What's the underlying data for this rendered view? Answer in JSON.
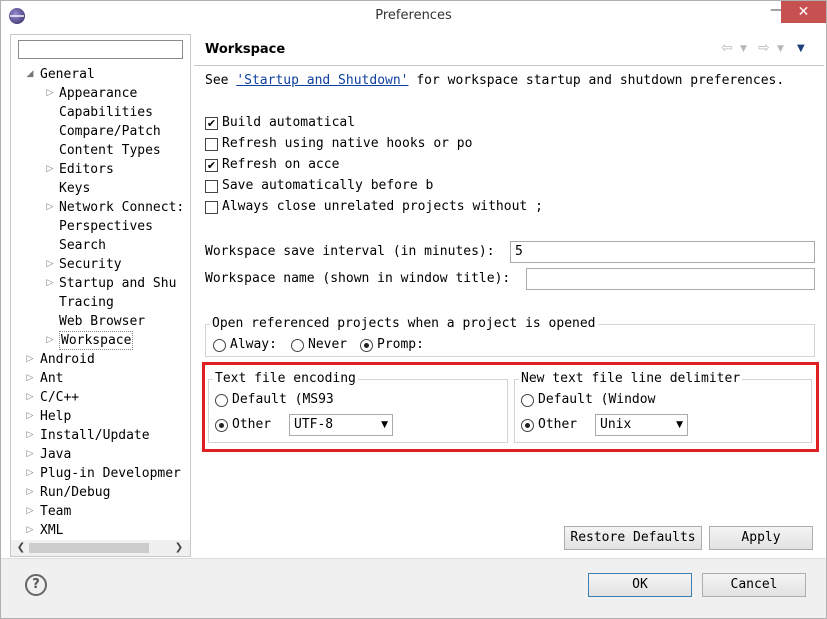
{
  "window": {
    "title": "Preferences",
    "minimize": "—",
    "close": "✕"
  },
  "filter": {
    "value": "",
    "placeholder": ""
  },
  "tree": {
    "general": "General",
    "appearance": "Appearance",
    "capabilities": "Capabilities",
    "compare_patch": "Compare/Patch",
    "content_types": "Content Types",
    "editors": "Editors",
    "keys": "Keys",
    "network": "Network Connect:",
    "perspectives": "Perspectives",
    "search": "Search",
    "security": "Security",
    "startup": "Startup and Shu",
    "tracing": "Tracing",
    "web_browser": "Web Browser",
    "workspace": "Workspace",
    "android": "Android",
    "ant": "Ant",
    "cpp": "C/C++",
    "help": "Help",
    "install": "Install/Update",
    "java": "Java",
    "plugin": "Plug-in Developmer",
    "run_debug": "Run/Debug",
    "team": "Team",
    "xml": "XML"
  },
  "page": {
    "title": "Workspace",
    "see_prefix": "See ",
    "see_link": "'Startup and Shutdown'",
    "see_suffix": " for workspace startup and shutdown preferences.",
    "build_auto": "Build automatical",
    "refresh_hooks": "Refresh using native hooks or po",
    "refresh_access": "Refresh on acce",
    "save_auto": "Save automatically before b",
    "close_unrelated": "Always close unrelated projects without ;",
    "save_interval_label": "Workspace save interval (in minutes):",
    "save_interval_value": "5",
    "ws_name_label": "Workspace name (shown in window title):",
    "ws_name_value": "",
    "open_ref_legend": "Open referenced projects when a project is opened",
    "always": "Alway:",
    "never": "Never",
    "prompt": "Promp:",
    "encoding_legend": "Text file encoding",
    "enc_default": "Default (MS93",
    "enc_other": "Other",
    "enc_value": "UTF-8",
    "delim_legend": "New text file line delimiter",
    "delim_default": "Default (Window",
    "delim_other": "Other",
    "delim_value": "Unix",
    "restore": "Restore Defaults",
    "apply": "Apply"
  },
  "footer": {
    "help": "?",
    "ok": "OK",
    "cancel": "Cancel"
  }
}
